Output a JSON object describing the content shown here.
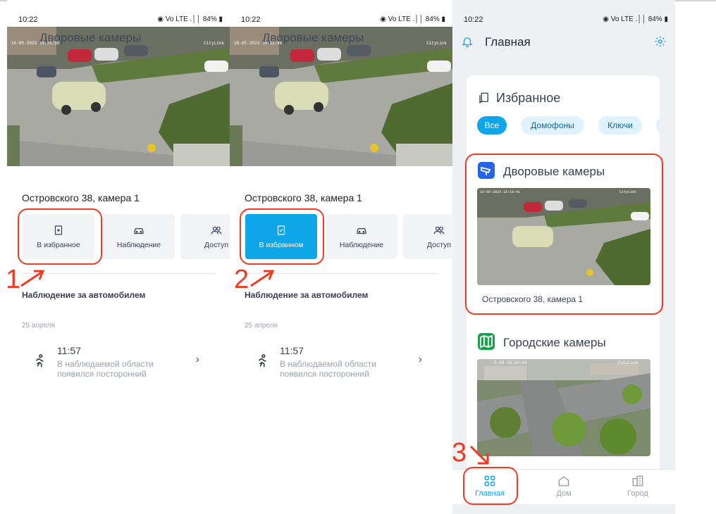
{
  "status": {
    "time": "10:22",
    "icons": "◉ Vo LTE .││ ",
    "battery": "84%"
  },
  "screen1": {
    "overlay_title": "Дворовые камеры",
    "cam_stamp": "16-05-2023 10:21:39",
    "cam_brand": "CityLink",
    "camera_title": "Островского 38, камера 1",
    "buttons": [
      "В избранное",
      "Наблюдение",
      "Доступ"
    ],
    "section": "Наблюдение за автомобилем",
    "date": "25 апреля",
    "event_time": "11:57",
    "event_text": "В наблюдаемой области появился посторонний",
    "step": "1"
  },
  "screen2": {
    "overlay_title": "Дворовые камеры",
    "cam_stamp": "16-05-2023 10:21:46",
    "cam_brand": "CityLink",
    "camera_title": "Островского 38, камера 1",
    "buttons": [
      "В избранном",
      "Наблюдение",
      "Доступ"
    ],
    "section": "Наблюдение за автомобилем",
    "date": "25 апреля",
    "event_time": "11:57",
    "event_text": "В наблюдаемой области появился посторонний",
    "step": "2"
  },
  "screen3": {
    "header_title": "Главная",
    "favorites_title": "Избранное",
    "chips": [
      "Все",
      "Домофоны",
      "Ключи"
    ],
    "group1": {
      "title": "Дворовые камеры",
      "caption": "Островского 38, камера 1",
      "stamp": "16-05-2023 10:19:41",
      "brand": "CityLink"
    },
    "group2": {
      "title": "Городские камеры",
      "stamp": "5-20 10:20:04",
      "brand": "CityLink"
    },
    "nav": [
      "Главная",
      "Дом",
      "Город"
    ],
    "step": "3"
  },
  "colors": {
    "accent": "#0ea5e9",
    "highlight": "#ef3b22"
  }
}
